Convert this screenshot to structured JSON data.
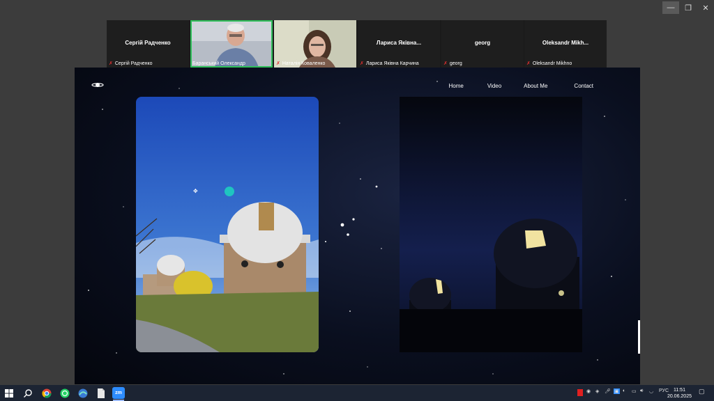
{
  "window": {
    "minimize_glyph": "—",
    "maximize_glyph": "❐",
    "close_glyph": "✕"
  },
  "participants": [
    {
      "display_name": "Сергій Радченко",
      "label": "Сергій Радченко",
      "video": false
    },
    {
      "display_name": "",
      "label": "Баранський Олександр",
      "video": true,
      "speaker": true
    },
    {
      "display_name": "",
      "label": "Наталія Коваленко",
      "video": true
    },
    {
      "display_name": "Лариса Яківна...",
      "label": "Лариса Яківна Карчина",
      "video": false
    },
    {
      "display_name": "georg",
      "label": "georg",
      "video": false
    },
    {
      "display_name": "Oleksandr Mikh...",
      "label": "Oleksandr Mikhno",
      "video": false
    }
  ],
  "shared_site": {
    "nav": [
      "Home",
      "Video",
      "About Me",
      "Contact"
    ]
  },
  "taskbar": {
    "icons": [
      "windows-start-icon",
      "search-icon",
      "chrome-icon",
      "whatsapp-icon",
      "browser-icon",
      "file-icon",
      "zoom-icon"
    ],
    "zoom_label": "zm",
    "language": "РУС",
    "time": "11:51",
    "date": "20.06.2025"
  },
  "colors": {
    "speaker_outline": "#2fbf5a",
    "muted": "#e03030",
    "taskbar": "#1c2433"
  }
}
